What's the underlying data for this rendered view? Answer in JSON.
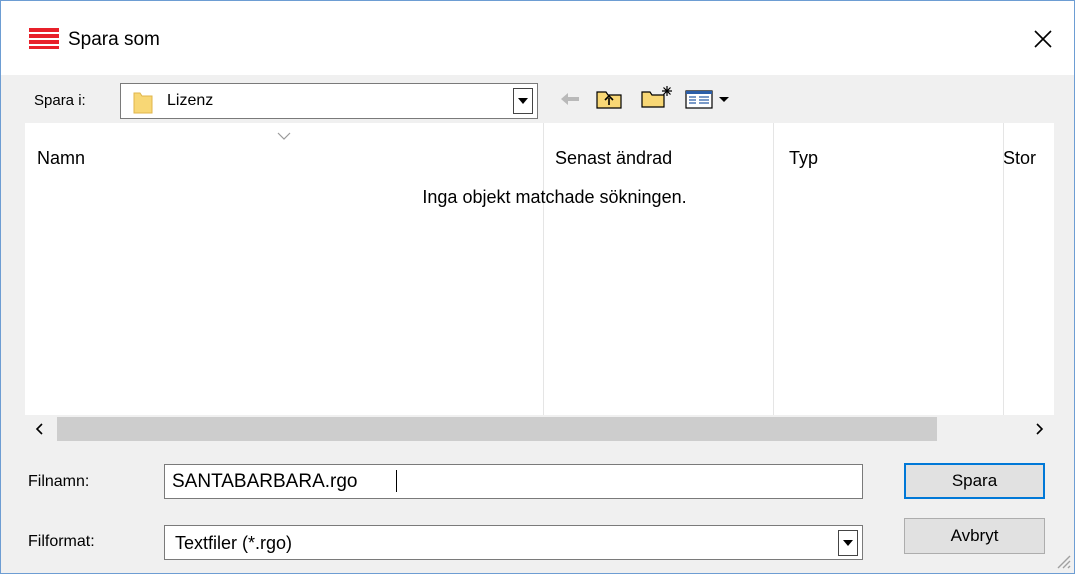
{
  "window": {
    "title": "Spara som",
    "close_glyph": "✕"
  },
  "toolbar": {
    "save_in_label": "Spara i:",
    "current_folder": "Lizenz",
    "icons": [
      "back-arrow-icon",
      "up-one-level-icon",
      "new-folder-icon",
      "view-menu-icon"
    ]
  },
  "filelist": {
    "columns": [
      "Namn",
      "Senast ändrad",
      "Typ",
      "Stor"
    ],
    "empty_message": "Inga objekt matchade sökningen."
  },
  "scrollbar": {
    "left_arrow": "‹",
    "right_arrow": "›"
  },
  "form": {
    "filename_label": "Filnamn:",
    "filename_value": "SANTABARBARA.rgo",
    "format_label": "Filformat:",
    "format_value": "Textfiler (*.rgo)"
  },
  "buttons": {
    "save": "Spara",
    "cancel": "Avbryt"
  },
  "colors": {
    "app_icon_red": "#e8202a",
    "folder_yellow": "#f8d775",
    "focus_blue": "#0078d7"
  }
}
